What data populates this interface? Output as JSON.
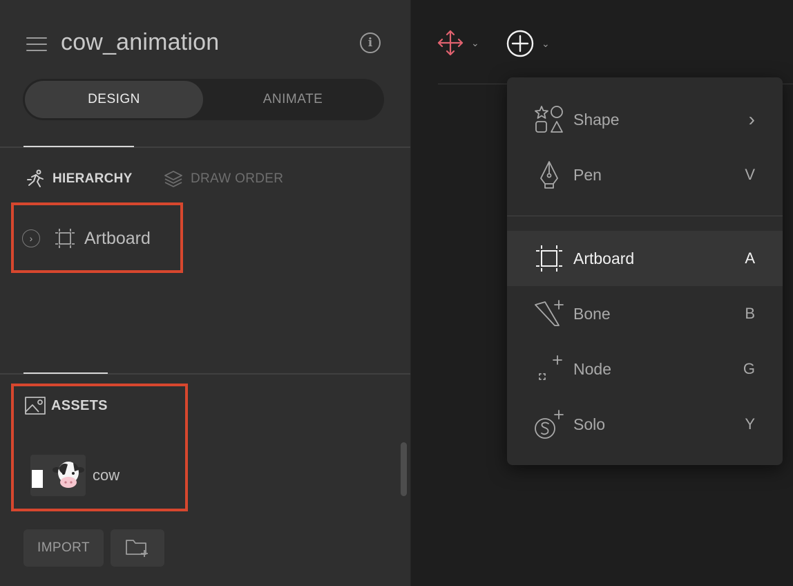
{
  "header": {
    "title": "cow_animation",
    "menu_icon": "hamburger-menu-icon",
    "info_icon": "info-icon",
    "info_glyph": "i"
  },
  "mode_tabs": {
    "design": "DESIGN",
    "animate": "ANIMATE",
    "selected": "DESIGN"
  },
  "section_tabs": {
    "hierarchy": "HIERARCHY",
    "draw_order": "DRAW ORDER",
    "selected": "HIERARCHY"
  },
  "hierarchy": {
    "items": [
      {
        "label": "Artboard",
        "icon": "artboard-icon",
        "expand_icon": "chevron-right-icon"
      }
    ]
  },
  "assets": {
    "heading": "ASSETS",
    "heading_icon": "image-icon",
    "items": [
      {
        "name": "cow",
        "thumbnail": "cow-thumbnail"
      }
    ],
    "import_label": "IMPORT",
    "new_folder_icon": "new-folder-icon"
  },
  "toolbar": {
    "move_tool_icon": "move-arrows-icon",
    "add_tool_icon": "add-circle-icon",
    "dropdown_icon": "chevron-down-icon",
    "move_tool_color": "#e0626f"
  },
  "add_menu": {
    "items": [
      {
        "label": "Shape",
        "shortcut": "›",
        "icon": "shapes-icon"
      },
      {
        "label": "Pen",
        "shortcut": "V",
        "icon": "pen-icon"
      },
      {
        "label": "Artboard",
        "shortcut": "A",
        "icon": "artboard-icon",
        "highlighted": true
      },
      {
        "label": "Bone",
        "shortcut": "B",
        "icon": "bone-icon"
      },
      {
        "label": "Node",
        "shortcut": "G",
        "icon": "node-icon"
      },
      {
        "label": "Solo",
        "shortcut": "Y",
        "icon": "solo-icon"
      }
    ]
  },
  "colors": {
    "panel_bg": "#2f2f2f",
    "canvas_bg": "#1e1e1e",
    "highlight_red": "#d7472e",
    "menu_bg": "#2c2c2c"
  }
}
